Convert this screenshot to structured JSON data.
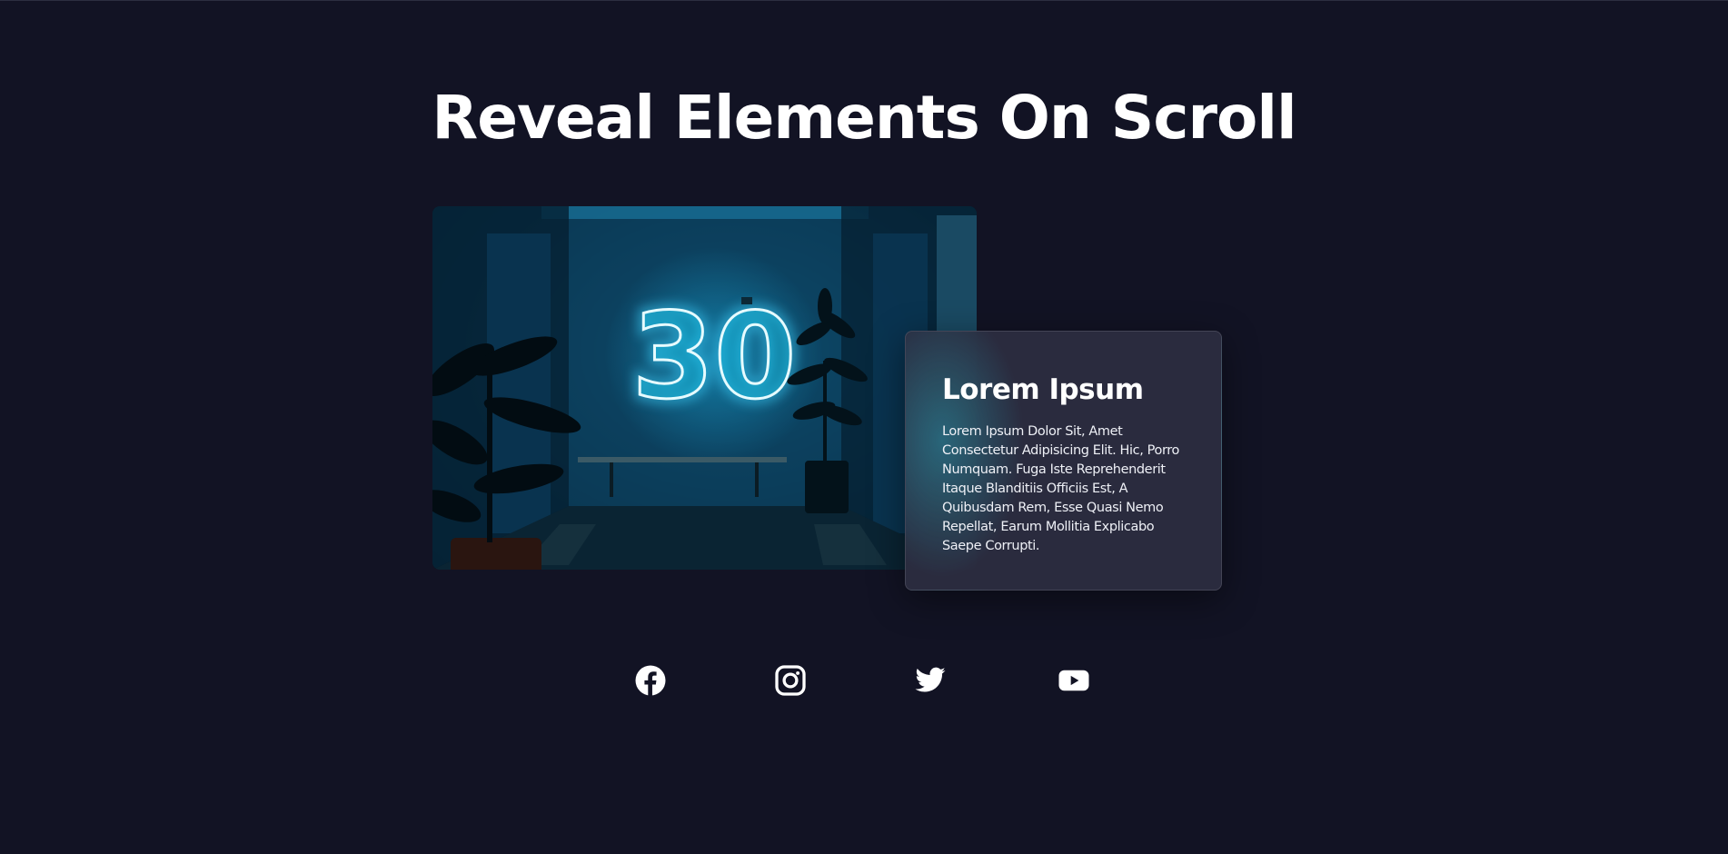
{
  "page": {
    "title": "Reveal Elements On Scroll"
  },
  "card": {
    "title": "Lorem Ipsum",
    "text": "Lorem Ipsum Dolor Sit, Amet Consectetur Adipisicing Elit. Hic, Porro Numquam. Fuga Iste Reprehenderit Itaque Blanditiis Officiis Est, A Quibusdam Rem, Esse Quasi Nemo Repellat, Earum Mollitia Explicabo Saepe Corrupti."
  },
  "photo": {
    "neon_text": "30"
  },
  "social": {
    "icons": [
      "facebook-icon",
      "instagram-icon",
      "twitter-icon",
      "youtube-icon"
    ]
  },
  "colors": {
    "background": "#121324",
    "card": "#2c2d40",
    "neon": "#3fd4ff",
    "text": "#ffffff"
  }
}
